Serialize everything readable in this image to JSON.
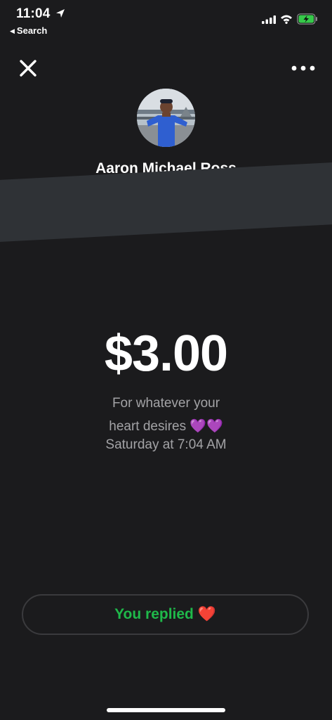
{
  "status_bar": {
    "time": "11:04",
    "back_label": "Search"
  },
  "profile": {
    "name": "Aaron Michael Ross"
  },
  "payment": {
    "amount": "$3.00",
    "note_line1": "For whatever your",
    "note_line2": "heart desires",
    "note_emoji": "💜💜",
    "date": "Saturday at 7:04 AM"
  },
  "reply": {
    "label": "You replied",
    "emoji": "❤️"
  },
  "icons": {
    "close": "close-icon",
    "more": "more-icon",
    "location": "location-arrow-icon",
    "signal": "signal-icon",
    "wifi": "wifi-icon",
    "battery": "battery-charging-icon"
  },
  "colors": {
    "background": "#1b1b1d",
    "reply_text": "#1fb94a",
    "secondary_text": "#a3a3a6",
    "battery_green": "#36c94a"
  }
}
